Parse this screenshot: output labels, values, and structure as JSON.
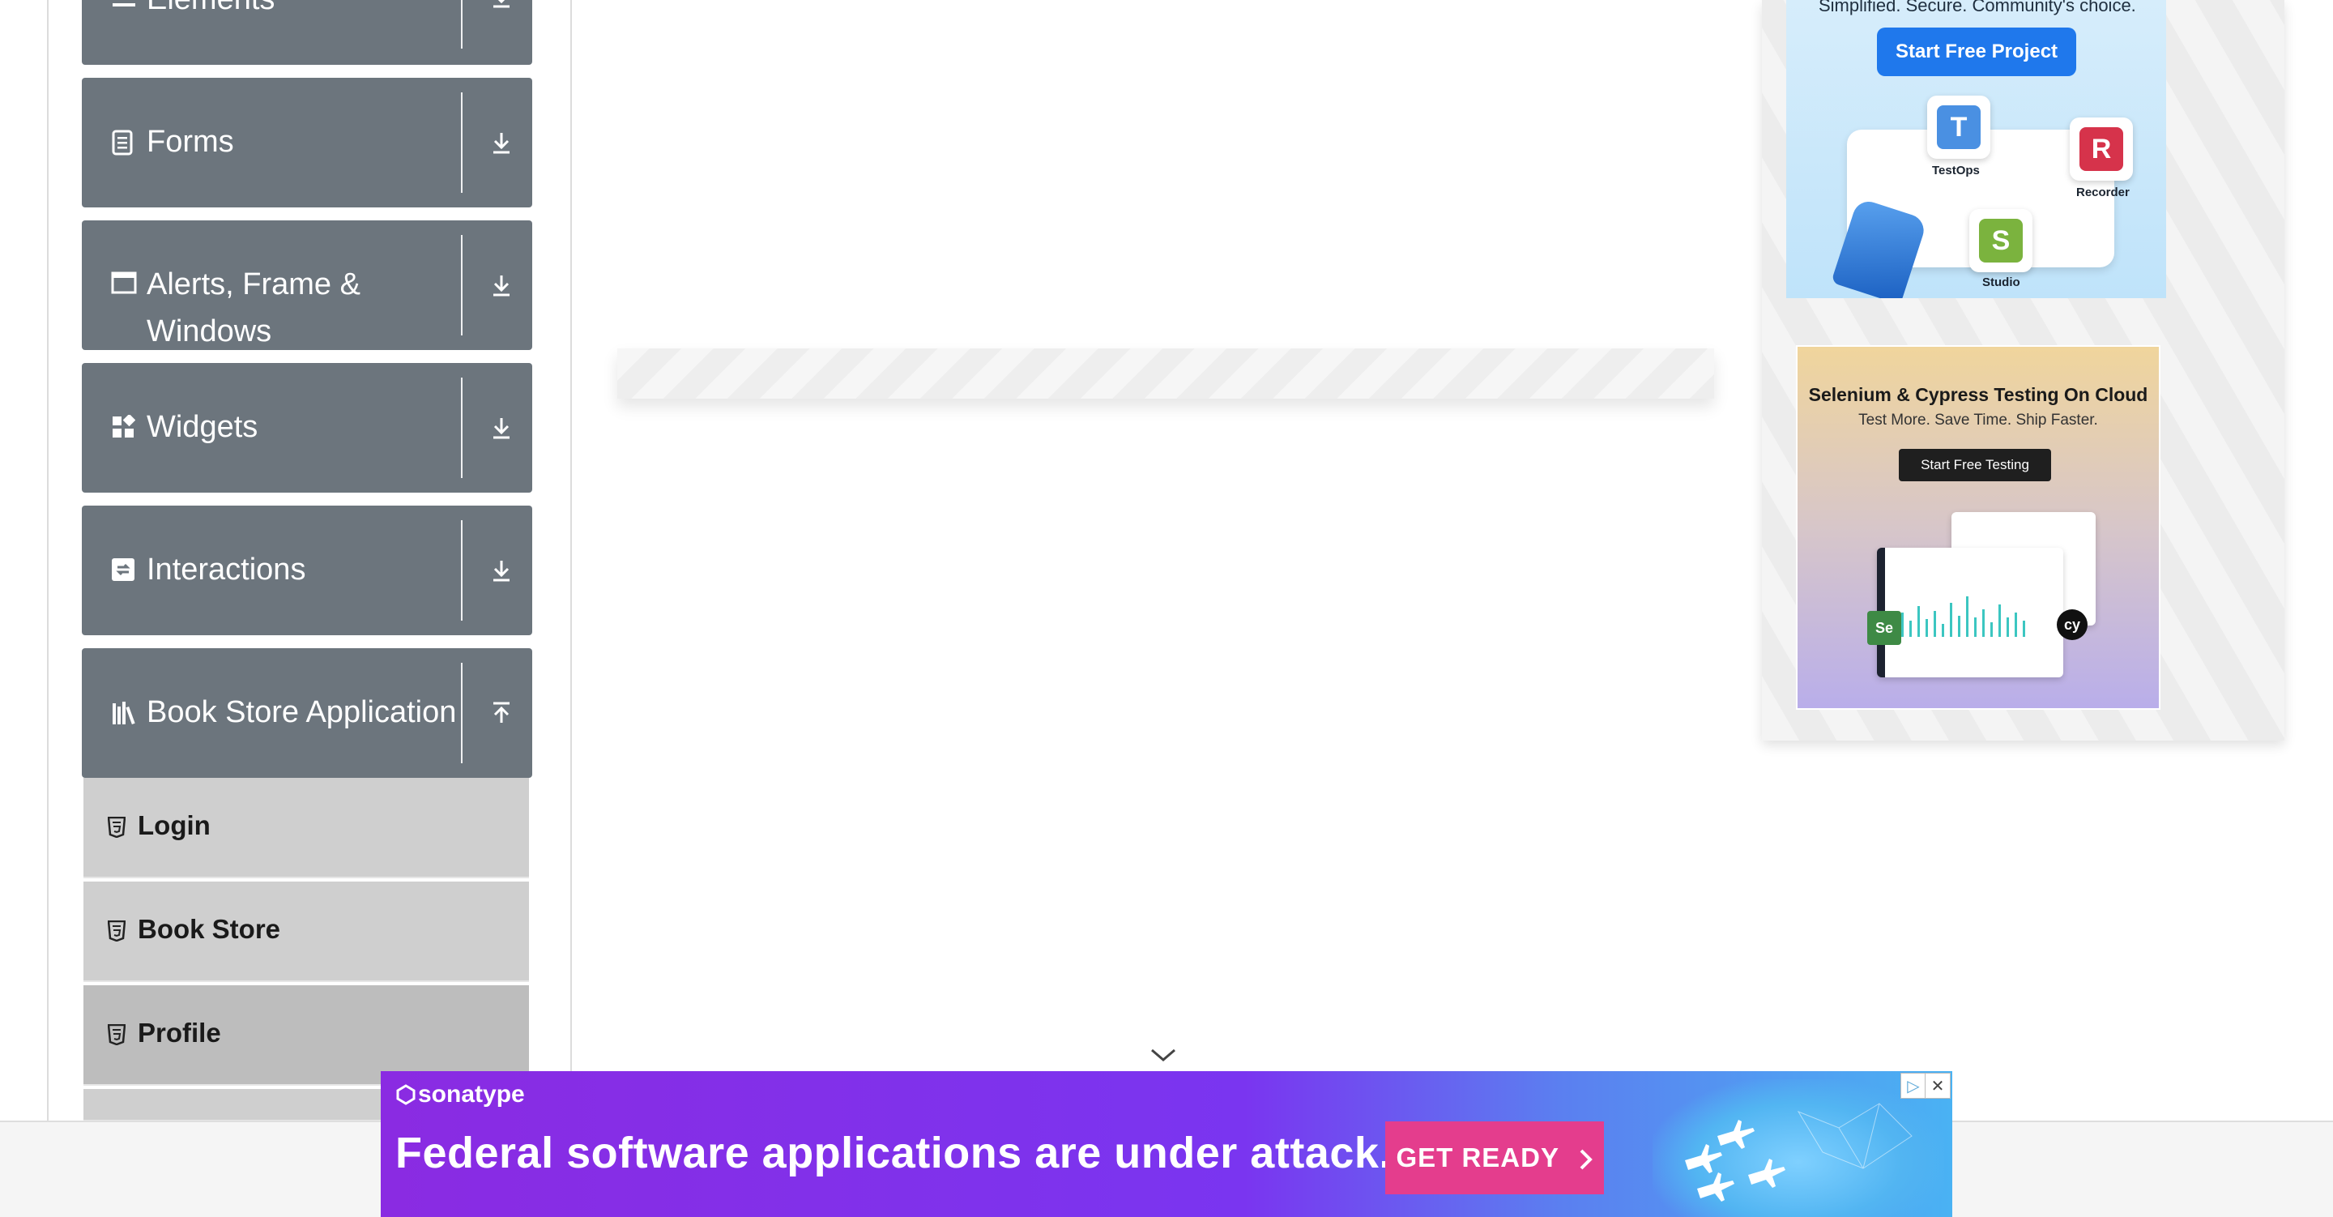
{
  "sidebar": {
    "groups": [
      {
        "label": "Elements",
        "icon": "list-icon",
        "toggle": "download-arrow-icon"
      },
      {
        "label": "Forms",
        "icon": "document-icon",
        "toggle": "download-arrow-icon"
      },
      {
        "label": "Alerts, Frame &",
        "label2": "Windows",
        "icon": "window-icon",
        "toggle": "download-arrow-icon"
      },
      {
        "label": "Widgets",
        "icon": "widgets-icon",
        "toggle": "download-arrow-icon"
      },
      {
        "label": "Interactions",
        "icon": "interactions-icon",
        "toggle": "download-arrow-icon"
      },
      {
        "label": "Book Store Application",
        "icon": "books-icon",
        "toggle": "upload-arrow-icon"
      }
    ],
    "book_store_items": [
      {
        "label": "Login",
        "icon": "html5-icon"
      },
      {
        "label": "Book Store",
        "icon": "html5-icon"
      },
      {
        "label": "Profile",
        "icon": "html5-icon"
      }
    ]
  },
  "ads": {
    "katalon": {
      "tagline": "Simplified. Secure. Community's choice.",
      "cta": "Start Free Project",
      "tiles": [
        "TestOps",
        "Recorder",
        "Studio"
      ],
      "tile_letters": [
        "T",
        "R",
        "S"
      ]
    },
    "lambdatest": {
      "title": "Selenium & Cypress Testing On Cloud",
      "subtitle": "Test More. Save Time. Ship Faster.",
      "cta": "Start Free Testing",
      "badges": [
        "Se",
        "cy"
      ]
    },
    "sonatype": {
      "brand": "sonatype",
      "headline": "Federal software applications are under attack.",
      "cta": "GET READY",
      "adchoices_icon": "adchoices-icon",
      "close_icon": "close-icon"
    }
  },
  "colors": {
    "sidebar_group_bg": "#6c757d",
    "submenu_bg": "#cfcfcf",
    "banner_cta": "#e43d8d",
    "katalon_cta": "#1f78ec"
  }
}
